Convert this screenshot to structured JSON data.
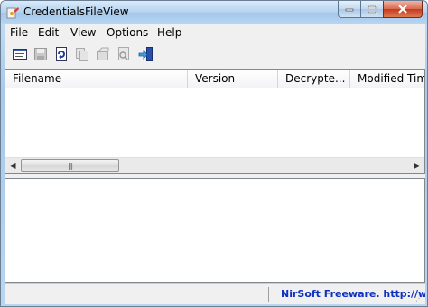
{
  "window": {
    "title": "CredentialsFileView"
  },
  "menu": {
    "items": [
      "File",
      "Edit",
      "View",
      "Options",
      "Help"
    ]
  },
  "toolbar": {
    "buttons": [
      {
        "icon": "properties-icon",
        "enabled": true
      },
      {
        "icon": "save-icon",
        "enabled": false
      },
      {
        "icon": "refresh-icon",
        "enabled": true
      },
      {
        "icon": "copy-icon",
        "enabled": false
      },
      {
        "icon": "html-report-icon",
        "enabled": false
      },
      {
        "icon": "find-icon",
        "enabled": false
      },
      {
        "icon": "exit-icon",
        "enabled": true
      }
    ]
  },
  "list": {
    "columns": [
      "Filename",
      "Version",
      "Decrypte...",
      "Modified Time"
    ],
    "rows": []
  },
  "status": {
    "left_text": "",
    "link_text": "NirSoft Freeware.  http://www.nirsoft.net"
  },
  "colors": {
    "link": "#1030c0",
    "close_button": "#c53a1e"
  }
}
